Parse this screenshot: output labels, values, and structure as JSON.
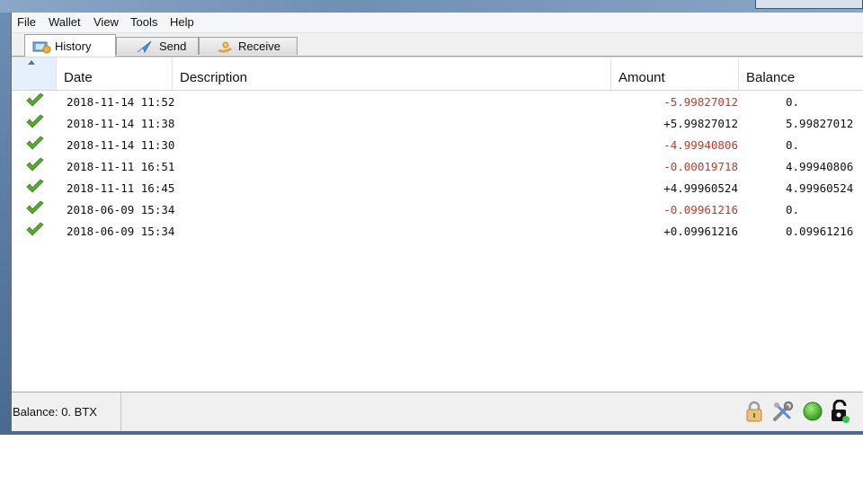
{
  "menu": [
    "File",
    "Wallet",
    "View",
    "Tools",
    "Help"
  ],
  "tabs": [
    {
      "label": "History",
      "icon": "history-icon",
      "active": true
    },
    {
      "label": "Send",
      "icon": "send-icon",
      "active": false
    },
    {
      "label": "Receive",
      "icon": "receive-icon",
      "active": false
    }
  ],
  "table": {
    "headers": {
      "date": "Date",
      "description": "Description",
      "amount": "Amount",
      "balance": "Balance"
    },
    "rows": [
      {
        "status": "confirmed-check-icon",
        "date": "2018-11-14 11:52",
        "description": "",
        "amount": "-5.99827012",
        "balance": "0."
      },
      {
        "status": "confirmed-check-icon",
        "date": "2018-11-14 11:38",
        "description": "",
        "amount": "+5.99827012",
        "balance": "5.99827012"
      },
      {
        "status": "confirmed-check-icon",
        "date": "2018-11-14 11:30",
        "description": "",
        "amount": "-4.99940806",
        "balance": "0."
      },
      {
        "status": "confirmed-check-icon",
        "date": "2018-11-11 16:51",
        "description": "",
        "amount": "-0.00019718",
        "balance": "4.99940806"
      },
      {
        "status": "confirmed-check-icon",
        "date": "2018-11-11 16:45",
        "description": "",
        "amount": "+4.99960524",
        "balance": "4.99960524"
      },
      {
        "status": "confirmed-check-icon",
        "date": "2018-06-09 15:34",
        "description": "",
        "amount": "-0.09961216",
        "balance": "0."
      },
      {
        "status": "confirmed-check-icon",
        "date": "2018-06-09 15:34",
        "description": "",
        "amount": "+0.09961216",
        "balance": "0.09961216"
      }
    ]
  },
  "status": {
    "balance_text": "Balance: 0. BTX",
    "icons": [
      "lock-icon",
      "tools-icon",
      "connection-green-icon",
      "encryption-icon"
    ]
  },
  "colors": {
    "negative": "#c0392b",
    "positive": "#111111",
    "check": "#5aa832"
  }
}
